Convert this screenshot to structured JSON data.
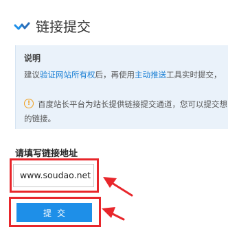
{
  "header": {
    "title": "链接提交"
  },
  "info": {
    "heading": "说明",
    "line1_prefix": "建议",
    "line1_link1": "验证网站所有权",
    "line1_mid": "后，再使用",
    "line1_link2": "主动推送",
    "line1_suffix": "工具实时提交，",
    "notice_icon": "!",
    "line2": "百度站长平台为站长提供链接提交通道，您可以提交想",
    "line3": "的链接。"
  },
  "form": {
    "label": "请填写链接地址",
    "url_value": "www.soudao.net",
    "submit_label": "提交"
  },
  "colors": {
    "accent": "#1e8fe8",
    "link": "#1a7fd4",
    "annotation": "#e8262b",
    "info_bg": "#eaf2fa"
  }
}
